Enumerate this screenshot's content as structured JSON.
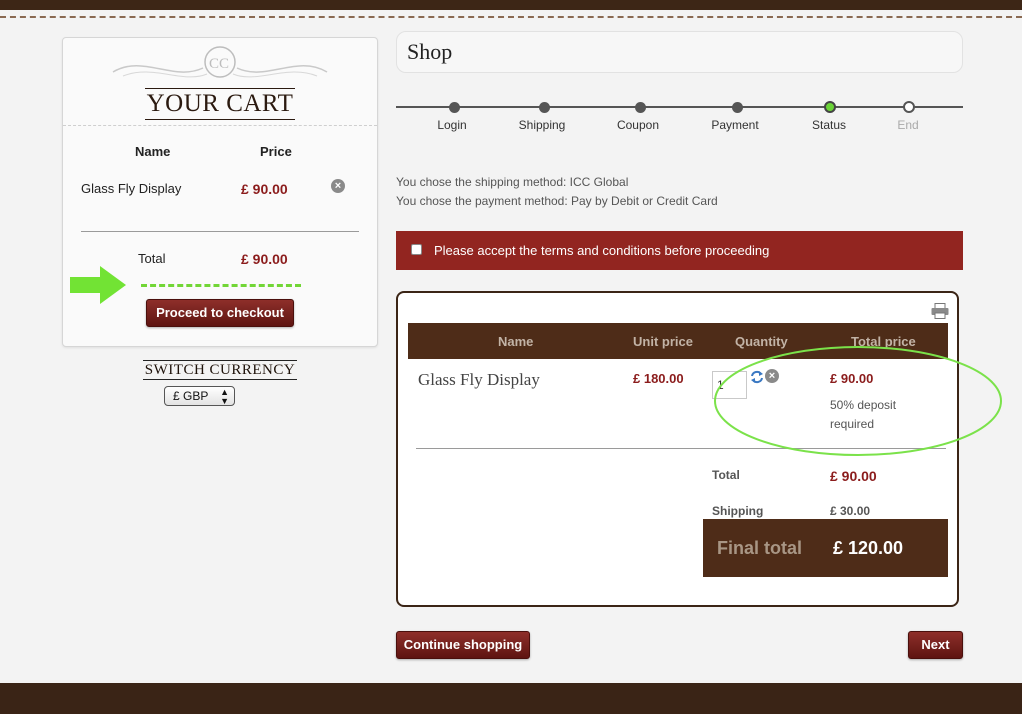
{
  "cart": {
    "title": "YOUR CART",
    "col_name": "Name",
    "col_price": "Price",
    "item_name": "Glass Fly Display",
    "item_price": "£ 90.00",
    "total_label": "Total",
    "total_value": "£ 90.00",
    "checkout_label": "Proceed to checkout"
  },
  "currency": {
    "heading": "SWITCH CURRENCY",
    "selected": "£ GBP"
  },
  "shop": {
    "title": "Shop",
    "steps": [
      "Login",
      "Shipping",
      "Coupon",
      "Payment",
      "Status",
      "End"
    ],
    "current_step": "Status",
    "shipping_info": "You chose the shipping method: ICC Global",
    "payment_info": "You chose the payment method: Pay by Debit or Credit Card",
    "terms_text": "Please accept the terms and conditions before proceeding"
  },
  "order": {
    "headers": [
      "Name",
      "Unit price",
      "Quantity",
      "Total price"
    ],
    "product_name": "Glass Fly Display",
    "unit_price": "£ 180.00",
    "quantity": "1",
    "total_price": "£ 90.00",
    "deposit_note": "50% deposit required",
    "total_label": "Total",
    "total_value": "£ 90.00",
    "shipping_label": "Shipping",
    "shipping_value": "£ 30.00",
    "final_label": "Final total",
    "final_value": "£ 120.00"
  },
  "buttons": {
    "continue": "Continue shopping",
    "next": "Next"
  },
  "colors": {
    "accent_red": "#922520",
    "brown": "#4e2c18",
    "highlight_green": "#6bd438"
  },
  "icons": [
    "cart-logo-icon",
    "remove-icon",
    "refresh-icon",
    "print-icon",
    "arrow-right-icon"
  ]
}
